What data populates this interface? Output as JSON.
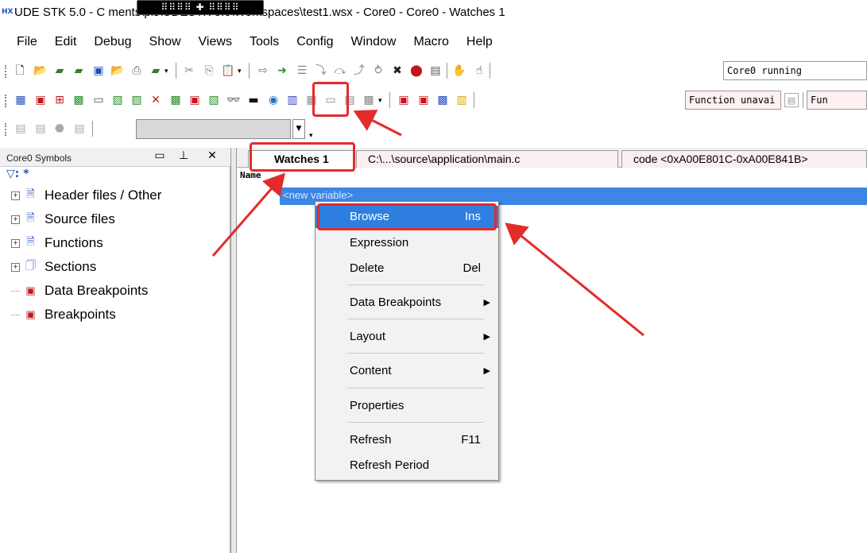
{
  "window": {
    "logo_text": "HX",
    "title": "UDE STK 5.0 - C                          ments\\pls\\UDESTK 5.0\\Workspaces\\test1.wsx - Core0 - Core0 - Watches 1",
    "overlay_text": "⠿⠿⠿⠿ ✚ ⠿⠿⠿⠿"
  },
  "menubar": {
    "items": [
      "File",
      "Edit",
      "Debug",
      "Show",
      "Views",
      "Tools",
      "Config",
      "Window",
      "Macro",
      "Help"
    ]
  },
  "toolbar": {
    "status_text": "Core0 running",
    "function_text": "Function unavai",
    "function_text_2": "Fun"
  },
  "symbols_panel": {
    "title": "Core0 Symbols",
    "filter": ": *",
    "tree": [
      {
        "label": "Header files / Other",
        "expandable": true
      },
      {
        "label": "Source files",
        "expandable": true
      },
      {
        "label": "Functions",
        "expandable": true
      },
      {
        "label": "Sections",
        "expandable": true
      },
      {
        "label": "Data Breakpoints",
        "expandable": false
      },
      {
        "label": "Breakpoints",
        "expandable": false
      }
    ]
  },
  "tabs": [
    {
      "label": "Watches 1",
      "active": true
    },
    {
      "label": "C:\\...\\source\\application\\main.c",
      "active": false
    },
    {
      "label": "code <0xA00E801C-0xA00E841B>",
      "active": false
    }
  ],
  "watch": {
    "column_name": "Name",
    "row_value": "<new variable>"
  },
  "context_menu": {
    "items": [
      {
        "label": "Browse",
        "shortcut": "Ins",
        "highlighted": true
      },
      {
        "label": "Expression",
        "shortcut": ""
      },
      {
        "label": "Delete",
        "shortcut": "Del"
      },
      {
        "label": "Data Breakpoints",
        "submenu": true
      },
      {
        "label": "Layout",
        "submenu": true
      },
      {
        "label": "Content",
        "submenu": true
      },
      {
        "label": "Properties",
        "shortcut": ""
      },
      {
        "label": "Refresh",
        "shortcut": "F11"
      },
      {
        "label": "Refresh Period",
        "shortcut": ""
      }
    ]
  },
  "colors": {
    "annotation": "#e32b2b",
    "selection": "#3c86e6",
    "menu_highlight": "#2f7fe0"
  }
}
